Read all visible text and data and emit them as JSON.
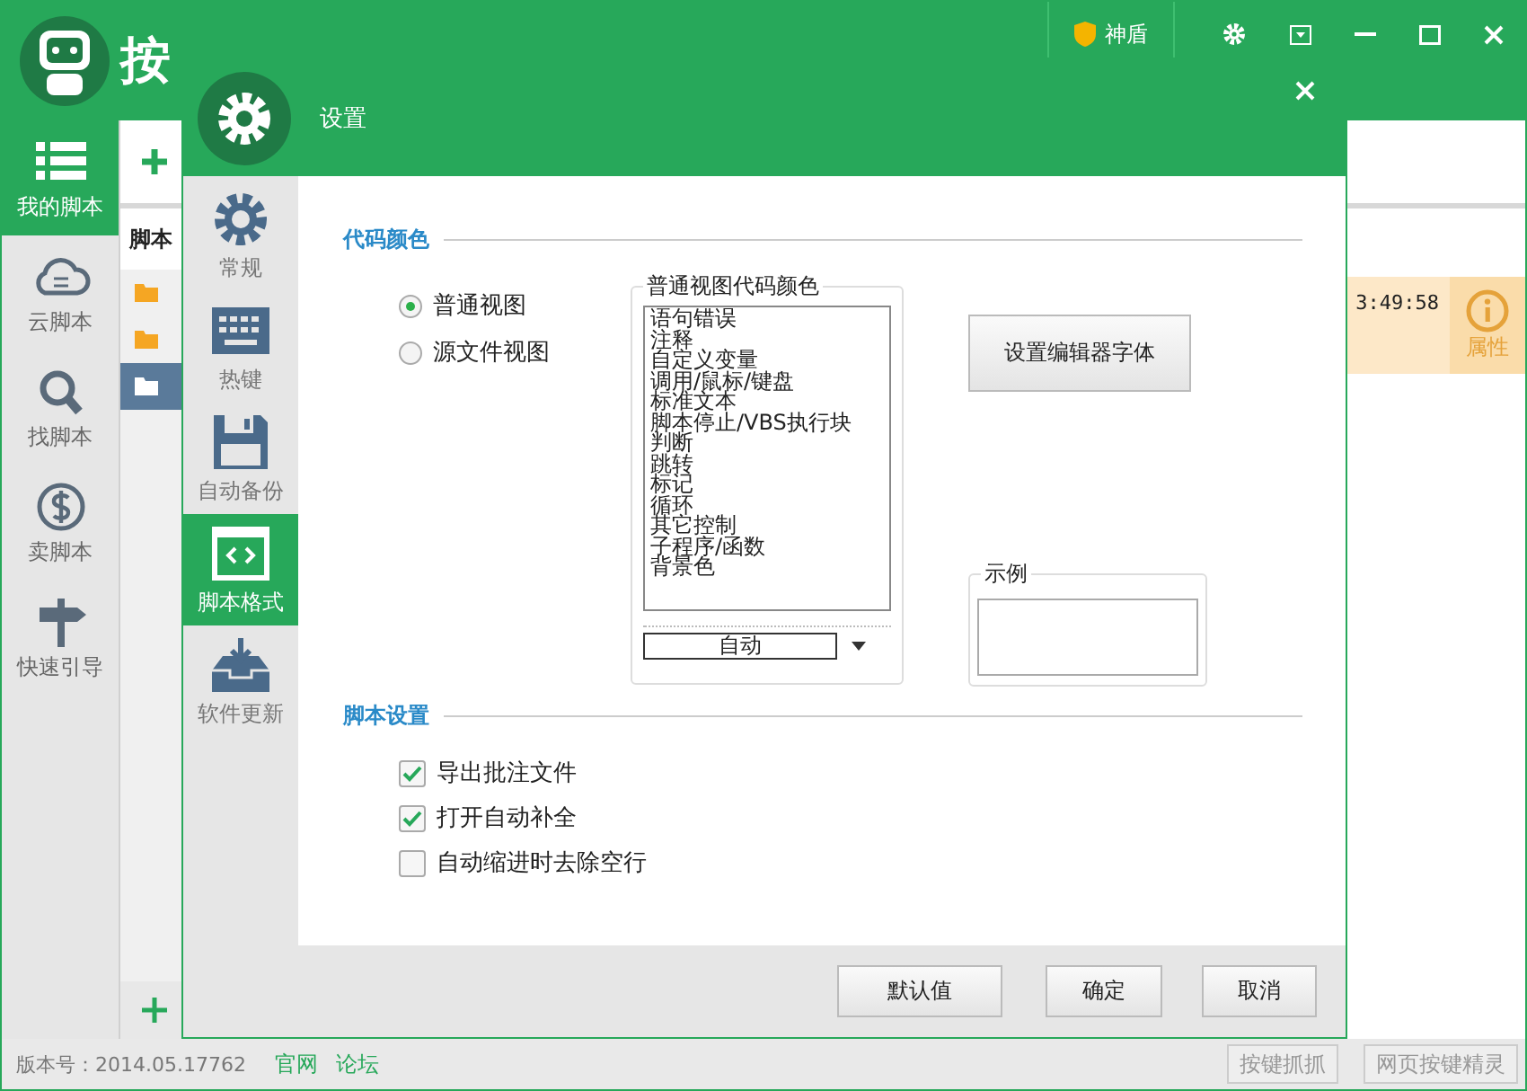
{
  "app": {
    "title": "按",
    "shield": "神盾"
  },
  "nav": [
    {
      "label": "我的脚本",
      "selected": true
    },
    {
      "label": "云脚本",
      "selected": false
    },
    {
      "label": "找脚本",
      "selected": false
    },
    {
      "label": "卖脚本",
      "selected": false
    },
    {
      "label": "快速引导",
      "selected": false
    }
  ],
  "tree": {
    "header": "脚本",
    "folders": [
      {
        "selected": false
      },
      {
        "selected": false
      },
      {
        "selected": true
      }
    ]
  },
  "script_row": {
    "time": "3:49:58",
    "properties": "属性"
  },
  "status_bar": {
    "version": "版本号：2014.05.17762",
    "links": [
      "官网",
      "论坛"
    ],
    "buttons": [
      "按键抓抓",
      "网页按键精灵"
    ]
  },
  "dialog": {
    "title": "设置",
    "nav": [
      {
        "label": "常规",
        "selected": false
      },
      {
        "label": "热键",
        "selected": false
      },
      {
        "label": "自动备份",
        "selected": false
      },
      {
        "label": "脚本格式",
        "selected": true
      },
      {
        "label": "软件更新",
        "selected": false
      }
    ],
    "code_color": {
      "heading": "代码颜色",
      "views": [
        {
          "label": "普通视图",
          "selected": true
        },
        {
          "label": "源文件视图",
          "selected": false
        }
      ],
      "list_title": "普通视图代码颜色",
      "items": [
        "语句错误",
        "注释",
        "自定义变量",
        "调用/鼠标/键盘",
        "标准文本",
        "脚本停止/VBS执行块",
        "判断",
        "跳转",
        "标记",
        "循环",
        "其它控制",
        "子程序/函数",
        "背景色"
      ],
      "color_select": "自动",
      "font_button": "设置编辑器字体",
      "sample_title": "示例"
    },
    "script_settings": {
      "heading": "脚本设置",
      "options": [
        {
          "label": "导出批注文件",
          "checked": true
        },
        {
          "label": "打开自动补全",
          "checked": true
        },
        {
          "label": "自动缩进时去除空行",
          "checked": false
        }
      ]
    },
    "buttons": [
      "默认值",
      "确定",
      "取消"
    ]
  }
}
